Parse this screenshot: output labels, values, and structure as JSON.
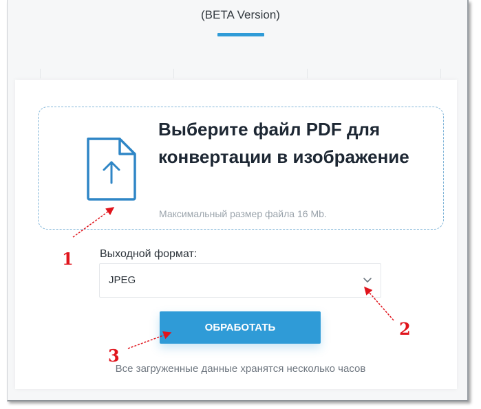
{
  "header": {
    "beta_label": "(BETA Version)"
  },
  "upload": {
    "title": "Выберите файл PDF для конвертации в изображение",
    "max_size_note": "Максимальный размер файла 16 Mb."
  },
  "format": {
    "label": "Выходной формат:",
    "selected": "JPEG"
  },
  "process_button": "ОБРАБОТАТЬ",
  "storage_note": "Все загруженные данные хранятся несколько часов",
  "annotations": {
    "m1": "1",
    "m2": "2",
    "m3": "3"
  },
  "colors": {
    "accent": "#2f9bd7",
    "marker": "#e0141c",
    "title": "#1d2733"
  },
  "icons": {
    "upload": "file-upload-icon",
    "dropdown": "chevron-down-icon"
  }
}
